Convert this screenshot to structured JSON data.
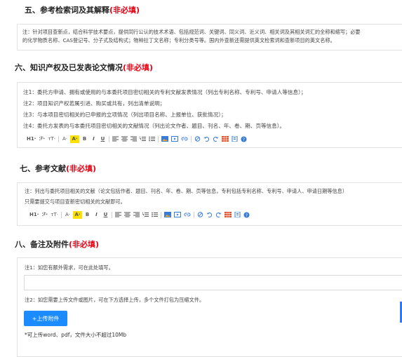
{
  "sections": [
    {
      "title": "五、参考检索词及其解释",
      "required_tag": "(非必填)",
      "notes": [
        "注：针对项目查新点，结合科学技术要点，提供同行公认的技术术语、包括规范词、关键词、同义词、近义词、相关词及其相关词汇的全称和缩写；必要",
        "的化学物质名称、CAS登记号、分子式及结构式；物种拉丁文名称；专利分类号等。国内外查新还需提供英文检索词和查新项目的英文名称。"
      ]
    },
    {
      "title": "六、知识产权及已发表论文情况",
      "required_tag": "(非必填)",
      "notes": [
        "注1：委托方申请、拥有或使用的与本委托项目密切相关的专利文献发表情况（列出专利名称、专利号、申请人等信息）；",
        "注2：项目知识产权若属引进、购买或共有，列出清单说明；",
        "注3：与本项目密切相关的已申报的立项情况（列出项目名称、上报单位、获批情况）；",
        "注4：委托方发表的与本委托项目密切相关的文献情况（列出论文作者、题目、刊名、年、卷、期、页等信息）。"
      ]
    },
    {
      "title": "七、参考文献",
      "required_tag": "(非必填)",
      "notes": [
        "注：列出与委托项目相关的文献（论文包括作者、题目、刊名、年、卷、期、页等信息，专利包括专利名称、专利号、申请人、申请日期等信息）",
        "只需要提交与项目查新密切相关的文献即可。"
      ]
    },
    {
      "title": "八、备注及附件",
      "required_tag": "(非必填)",
      "notes": [
        "注1：如您有额外需求，可在此处填写。",
        "注2：如您需要上传文件或图片，可在下方选择上传，多个文件打包为压缩文件。"
      ]
    }
  ],
  "toolbar": {
    "heading": "H1·",
    "font_family": "ℱ·",
    "font_size": "тT·",
    "font_color": "A·",
    "highlight": "A·",
    "bold": "B",
    "italic": "I",
    "underline": "U"
  },
  "icons": [
    "align-left-icon",
    "align-center-icon",
    "align-right-icon",
    "ordered-list-icon",
    "unordered-list-icon",
    "image-icon",
    "video-icon",
    "link-icon",
    "clear-format-icon",
    "undo-icon",
    "redo-icon",
    "table-icon",
    "attachment-icon",
    "help-icon"
  ],
  "colors": {
    "required": "#e60012",
    "accent": "#1a8cff",
    "highlight": "#ffe100"
  },
  "upload": {
    "button_label": "+上传附件",
    "hint": "*可上传word、pdf，文件大小不超过10Mb"
  }
}
